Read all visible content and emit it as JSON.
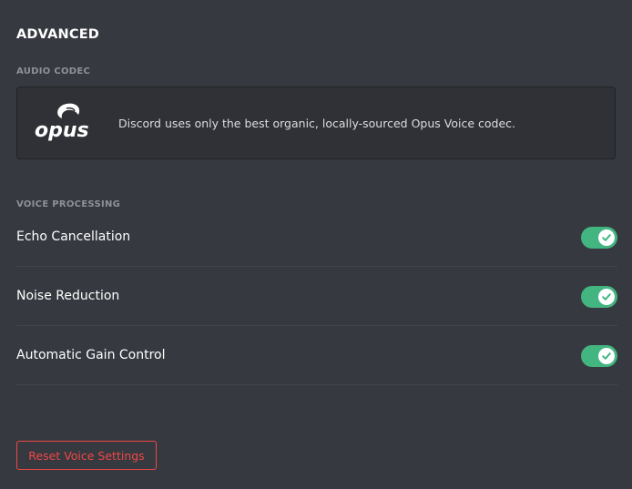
{
  "title": "ADVANCED",
  "audio_codec": {
    "section_label": "AUDIO CODEC",
    "logo_text": "opus",
    "logo_icon": "opus-logo-icon",
    "description": "Discord uses only the best organic, locally-sourced Opus Voice codec."
  },
  "voice_processing": {
    "section_label": "VOICE PROCESSING",
    "settings": [
      {
        "label": "Echo Cancellation",
        "enabled": true,
        "icon": "check-icon"
      },
      {
        "label": "Noise Reduction",
        "enabled": true,
        "icon": "check-icon"
      },
      {
        "label": "Automatic Gain Control",
        "enabled": true,
        "icon": "check-icon"
      }
    ]
  },
  "reset_button": {
    "label": "Reset Voice Settings"
  },
  "colors": {
    "background": "#36393f",
    "panel": "#2f3136",
    "toggle_on": "#43b581",
    "danger": "#f04747",
    "muted_label": "#8e9297"
  }
}
